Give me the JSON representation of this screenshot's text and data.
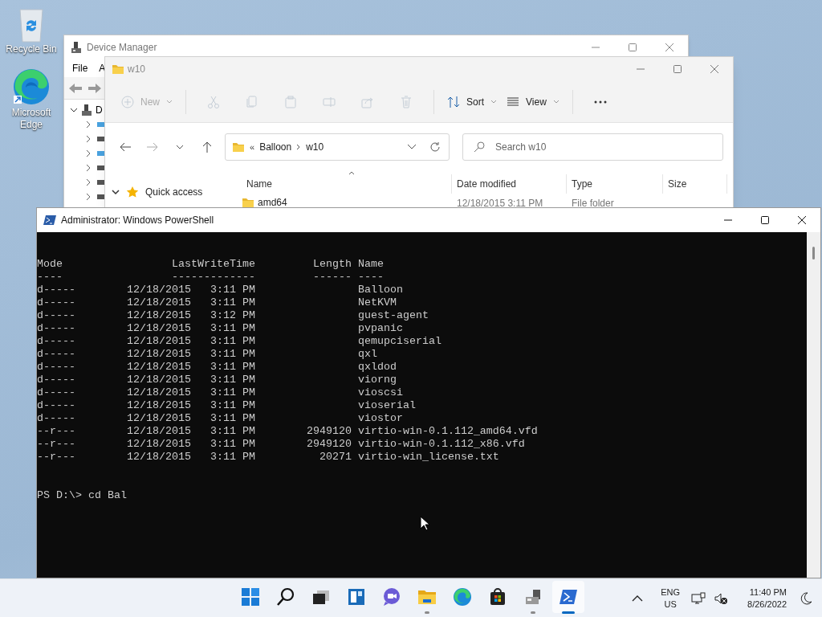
{
  "desktop_icons": [
    {
      "kind": "recycle_bin",
      "label": "Recycle Bin"
    },
    {
      "kind": "edge",
      "label": "Microsoft Edge"
    }
  ],
  "device_manager": {
    "title": "Device Manager",
    "menu": [
      "File",
      "A"
    ],
    "tree_root": {
      "label": "D",
      "expanded": true
    }
  },
  "explorer": {
    "title": "w10",
    "toolbar": [
      {
        "kind": "new",
        "label": "New",
        "disabled": true
      },
      {
        "kind": "cut",
        "disabled": true
      },
      {
        "kind": "copy",
        "disabled": true
      },
      {
        "kind": "paste",
        "disabled": true
      },
      {
        "kind": "rename",
        "disabled": true
      },
      {
        "kind": "share",
        "disabled": true
      },
      {
        "kind": "delete",
        "disabled": true
      },
      {
        "kind": "sort",
        "label": "Sort",
        "disabled": false
      },
      {
        "kind": "view",
        "label": "View",
        "disabled": false
      },
      {
        "kind": "more",
        "disabled": false
      }
    ],
    "breadcrumb_overflow": "«",
    "breadcrumb": [
      "Balloon",
      "w10"
    ],
    "search": {
      "placeholder": "Search w10"
    },
    "nav": [
      {
        "label": "Quick access",
        "expanded": true
      }
    ],
    "columns": [
      "Name",
      "Date modified",
      "Type",
      "Size"
    ],
    "rows": [
      {
        "name": "amd64",
        "date_modified": "12/18/2015 3:11 PM",
        "type": "File folder"
      }
    ]
  },
  "powershell": {
    "title": "Administrator: Windows PowerShell",
    "header": [
      "Mode                 LastWriteTime         Length Name",
      "----                 -------------         ------ ----"
    ],
    "rows": [
      "d-----        12/18/2015   3:11 PM                Balloon",
      "d-----        12/18/2015   3:11 PM                NetKVM",
      "d-----        12/18/2015   3:12 PM                guest-agent",
      "d-----        12/18/2015   3:11 PM                pvpanic",
      "d-----        12/18/2015   3:11 PM                qemupciserial",
      "d-----        12/18/2015   3:11 PM                qxl",
      "d-----        12/18/2015   3:11 PM                qxldod",
      "d-----        12/18/2015   3:11 PM                viorng",
      "d-----        12/18/2015   3:11 PM                vioscsi",
      "d-----        12/18/2015   3:11 PM                vioserial",
      "d-----        12/18/2015   3:11 PM                viostor",
      "--r---        12/18/2015   3:11 PM        2949120 virtio-win-0.1.112_amd64.vfd",
      "--r---        12/18/2015   3:11 PM        2949120 virtio-win-0.1.112_x86.vfd",
      "--r---        12/18/2015   3:11 PM          20271 virtio-win_license.txt"
    ],
    "prompt": "PS D:\\> cd Bal"
  },
  "taskbar": {
    "apps": [
      {
        "kind": "start",
        "running": false,
        "active": false
      },
      {
        "kind": "search",
        "running": false,
        "active": false
      },
      {
        "kind": "task_view",
        "running": false,
        "active": false
      },
      {
        "kind": "widgets",
        "running": false,
        "active": false
      },
      {
        "kind": "chat",
        "running": false,
        "active": false
      },
      {
        "kind": "explorer",
        "running": true,
        "active": false
      },
      {
        "kind": "edge",
        "running": false,
        "active": false
      },
      {
        "kind": "store",
        "running": false,
        "active": false
      },
      {
        "kind": "device_manager",
        "running": true,
        "active": false
      },
      {
        "kind": "powershell",
        "running": true,
        "active": true
      }
    ],
    "language": "ENG",
    "region": "US",
    "time": "11:40 PM",
    "date": "8/26/2022"
  }
}
